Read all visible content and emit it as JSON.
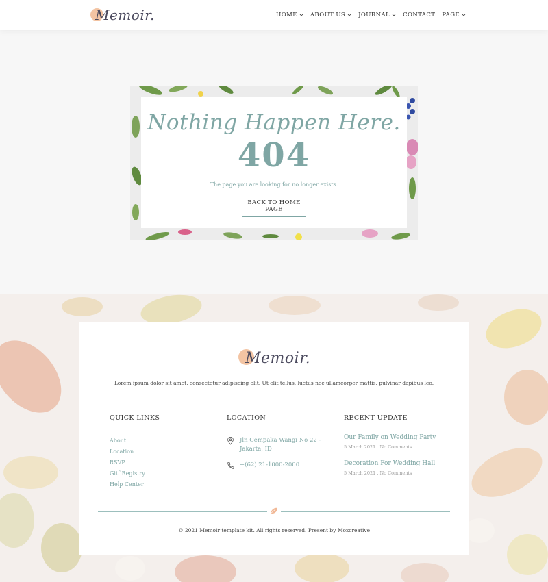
{
  "header": {
    "logo_text": "Memoir.",
    "nav": [
      {
        "label": "HOME",
        "has_dropdown": true
      },
      {
        "label": "ABOUT US",
        "has_dropdown": true
      },
      {
        "label": "JOURNAL",
        "has_dropdown": true
      },
      {
        "label": "CONTACT",
        "has_dropdown": false
      },
      {
        "label": "PAGE",
        "has_dropdown": true
      }
    ]
  },
  "error": {
    "title": "Nothing Happen Here.",
    "code": "404",
    "message": "The page you are looking for no longer exists.",
    "button_label": "BACK TO HOME PAGE"
  },
  "footer": {
    "logo_text": "Memoir.",
    "description": "Lorem ipsum dolor sit amet, consectetur adipiscing elit. Ut elit tellus, luctus nec ullamcorper mattis, pulvinar dapibus leo.",
    "quick_links": {
      "title": "QUICK LINKS",
      "items": [
        "About",
        "Location",
        "RSVP",
        "Gitf Registry",
        "Help Center"
      ]
    },
    "location": {
      "title": "LOCATION",
      "address_line1": "Jln Cempaka Wangi No 22 -",
      "address_line2": "Jakarta, ID",
      "phone": "+(62) 21-1000-2000"
    },
    "recent": {
      "title": "RECENT UPDATE",
      "posts": [
        {
          "title": "Our Family on Wedding Party",
          "meta": "5 March 2021 . No Comments"
        },
        {
          "title": "Decoration For Wedding Hall",
          "meta": "5 March 2021 . No Comments"
        }
      ]
    },
    "copyright": "© 2021 Memoir template kit. All rights reserved. Present by Moxcreative"
  },
  "colors": {
    "accent": "#7fa6a4",
    "peach": "#f3c4a3",
    "logo_dark": "#4b4a5e"
  }
}
